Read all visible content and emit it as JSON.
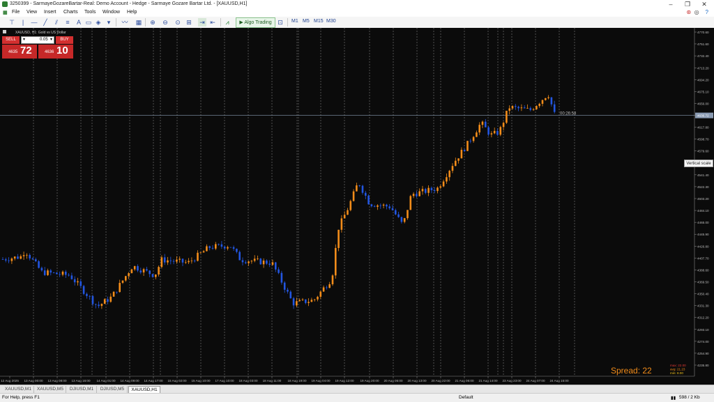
{
  "window": {
    "title": "3250399 - SarmayeGozareBartar-Real: Demo Account - Hedge - Sarmaye Gozare Bartar Ltd. - [XAUUSD,H1]",
    "controls": [
      "–",
      "❐",
      "✕"
    ]
  },
  "menu": [
    "File",
    "View",
    "Insert",
    "Charts",
    "Tools",
    "Window",
    "Help"
  ],
  "toolbar": {
    "algo_label": "Algo Trading",
    "timeframes": [
      "M1",
      "M5",
      "M15",
      "M30"
    ]
  },
  "chart": {
    "header": "XAUUSD, H1:  Gold vs US Dollar",
    "symbol": "XAUUSD",
    "timeframe": "H1",
    "bar_timer": "00:26:58",
    "current_price": "4636.72",
    "spread_label": "Spread:",
    "spread_value": "22",
    "spread_stats": {
      "max": "max: 22.00",
      "avg": "avg: 21.23",
      "min": "min: 8.00"
    },
    "tooltip": "Vertical scale",
    "y_ticks": [
      "4770.60",
      "4751.60",
      "4732.40",
      "4713.20",
      "4694.20",
      "4675.10",
      "4656.00",
      "4636.72",
      "4617.80",
      "4598.70",
      "4579.60",
      "4560.40",
      "4541.40",
      "4522.30",
      "4503.20",
      "4484.10",
      "4465.00",
      "4445.90",
      "4426.80",
      "4407.70",
      "4388.60",
      "4369.50",
      "4350.40",
      "4331.30",
      "4312.20",
      "4293.10",
      "4274.00",
      "4254.90",
      "4235.80"
    ],
    "x_ticks": [
      "12 Aug 2025",
      "13 Aug 00:00",
      "13 Aug 08:00",
      "13 Aug 16:00",
      "14 Aug 01:00",
      "14 Aug 09:00",
      "14 Aug 17:00",
      "15 Aug 02:00",
      "15 Aug 10:00",
      "17 Aug 10:00",
      "18 Aug 03:00",
      "18 Aug 11:00",
      "18 Aug 19:00",
      "19 Aug 04:00",
      "19 Aug 12:00",
      "19 Aug 20:00",
      "20 Aug 05:00",
      "20 Aug 13:00",
      "20 Aug 22:00",
      "21 Aug 06:00",
      "21 Aug 14:00",
      "23 Aug 23:00",
      "24 Aug 07:00",
      "24 Aug 15:00"
    ],
    "colors": {
      "bull": "#f28c1a",
      "bear": "#2356e0",
      "background": "#0b0b0b",
      "grid": "#cfcfcf"
    }
  },
  "trade_panel": {
    "sell_label": "SELL",
    "buy_label": "BUY",
    "lot": "0.05",
    "sell_small": "4635",
    "sell_big": "72",
    "buy_small": "4636",
    "buy_big": "10"
  },
  "tabs": [
    "XAUUSD,M1",
    "XAUUSD,M5",
    "DJIUSD,M1",
    "DJIUSD,M5",
    "XAUUSD,H1"
  ],
  "active_tab": "XAUUSD,H1",
  "status": {
    "help": "For Help, press F1",
    "profile": "Default",
    "traffic": "598 / 2 Kb"
  }
}
